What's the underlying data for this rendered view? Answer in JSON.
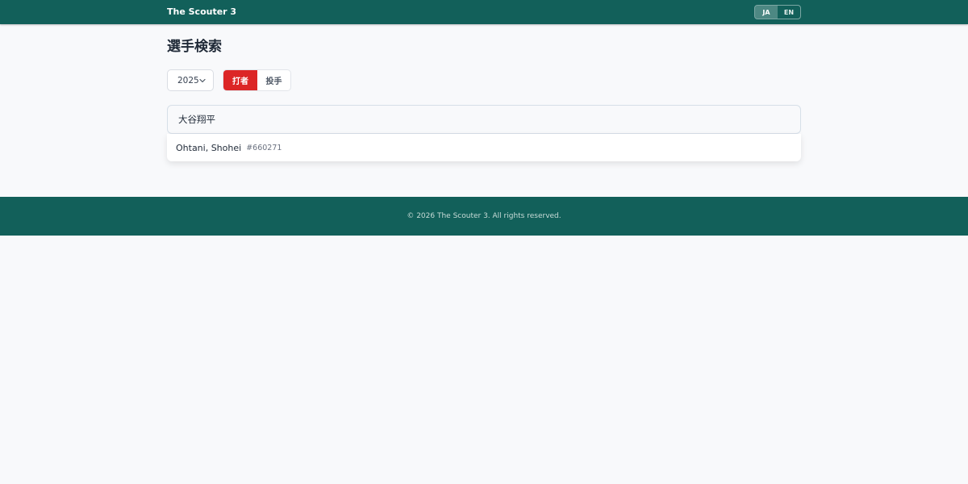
{
  "header": {
    "brand": "The Scouter 3",
    "languages": [
      {
        "label": "JA",
        "active": true
      },
      {
        "label": "EN",
        "active": false
      }
    ]
  },
  "main": {
    "title": "選手検索",
    "year_select": {
      "value": "2025"
    },
    "role_toggle": [
      {
        "label": "打者",
        "active": true
      },
      {
        "label": "投手",
        "active": false
      }
    ],
    "search": {
      "value": "大谷翔平"
    },
    "results": [
      {
        "name": "Ohtani, Shohei",
        "id": "#660271"
      }
    ]
  },
  "footer": {
    "text": "© 2026 The Scouter 3. All rights reserved."
  },
  "colors": {
    "brand_green": "#12605a",
    "accent_red": "#dc2626",
    "background": "#f8f9fb"
  }
}
